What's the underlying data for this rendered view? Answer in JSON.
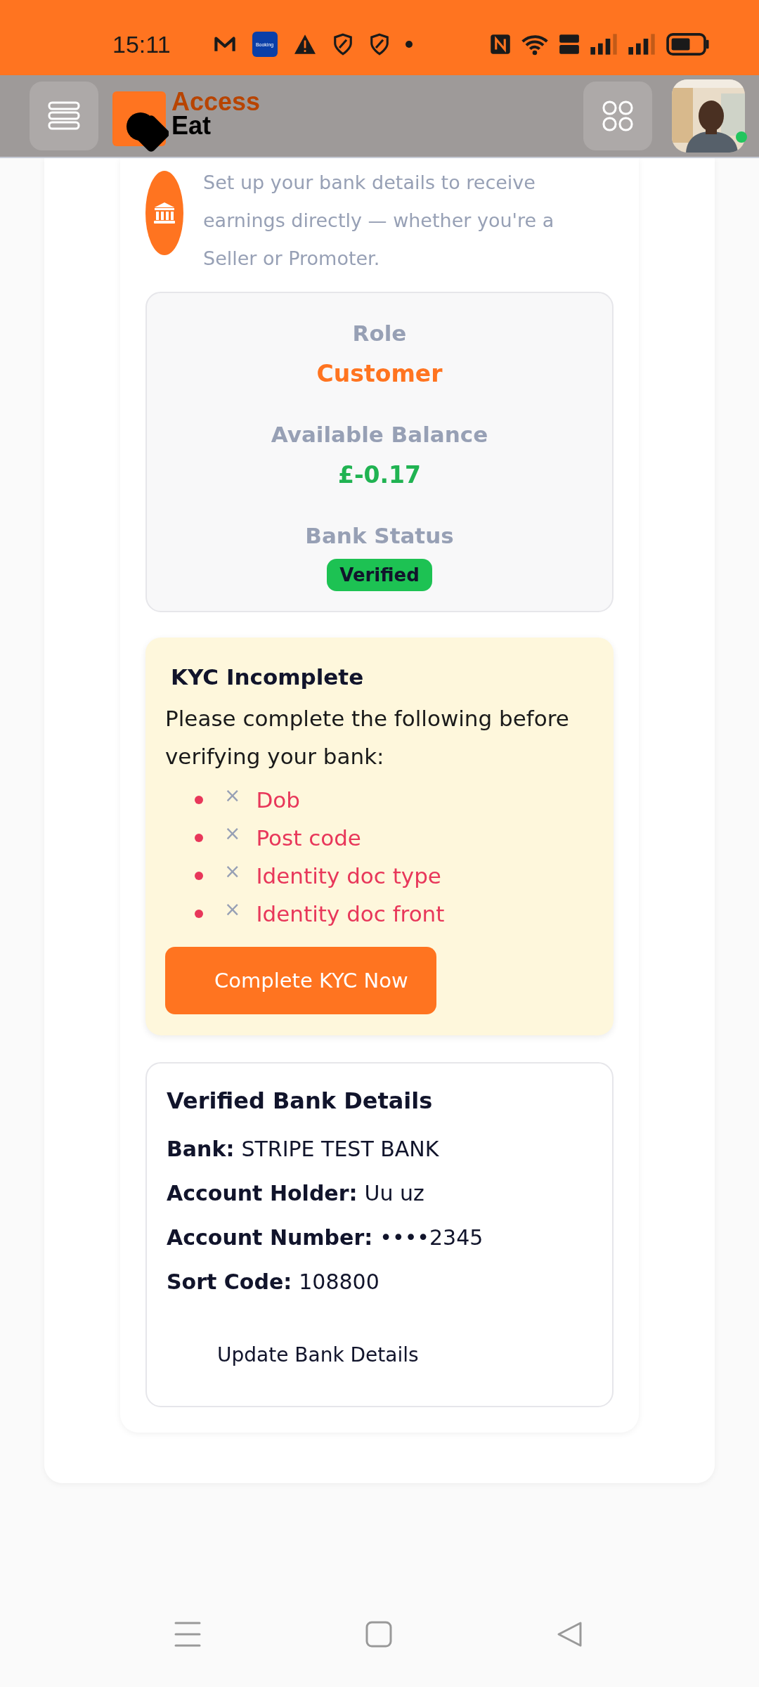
{
  "status_bar": {
    "time": "15:11",
    "app_badge": "Booking"
  },
  "header": {
    "logo_top": "Access",
    "logo_bottom": "Eat",
    "avatar_online": true
  },
  "intro": {
    "description": "Set up your bank details to receive earnings directly — whether you're a Seller or Promoter."
  },
  "summary": [
    {
      "label": "Role",
      "value": "Customer",
      "kind": "role"
    },
    {
      "label": "Available Balance",
      "value": "£-0.17",
      "kind": "amount"
    },
    {
      "label": "Bank Status",
      "value": "Verified",
      "kind": "badge"
    }
  ],
  "kyc": {
    "title": "KYC Incomplete",
    "message": "Please complete the following before verifying your bank:",
    "missing": [
      {
        "mark": "×",
        "label": "Dob"
      },
      {
        "mark": "×",
        "label": "Post code"
      },
      {
        "mark": "×",
        "label": "Identity doc type"
      },
      {
        "mark": "×",
        "label": "Identity doc front"
      }
    ],
    "button": "Complete KYC Now"
  },
  "bank": {
    "title": "Verified Bank Details",
    "fields": [
      {
        "label": "Bank:",
        "value": "STRIPE TEST BANK"
      },
      {
        "label": "Account Holder:",
        "value": "Uu uz"
      },
      {
        "label": "Account Number:",
        "value": "••••2345"
      },
      {
        "label": "Sort Code:",
        "value": "108800"
      }
    ],
    "button": "Update Bank Details"
  }
}
